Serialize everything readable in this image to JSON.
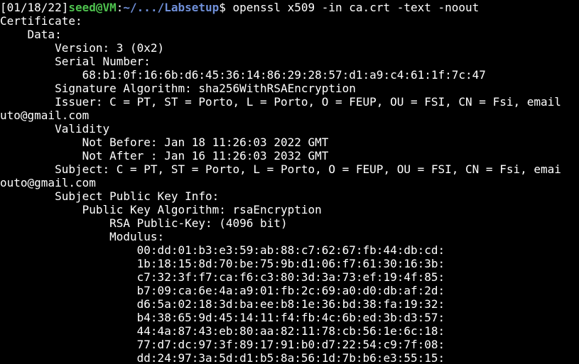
{
  "colors": {
    "background": "#000000",
    "text": "#ffffff",
    "user_host": "#4ec24e",
    "path": "#6f8fd8"
  },
  "prompt": {
    "date": "[01/18/22]",
    "user_host": "seed@VM",
    "colon": ":",
    "path": "~/.../Labsetup",
    "dollar": "$ ",
    "command": "openssl x509 -in ca.crt -text -noout"
  },
  "output_lines": [
    "Certificate:",
    "    Data:",
    "        Version: 3 (0x2)",
    "        Serial Number:",
    "            68:b1:0f:16:6b:d6:45:36:14:86:29:28:57:d1:a9:c4:61:1f:7c:47",
    "        Signature Algorithm: sha256WithRSAEncryption",
    "        Issuer: C = PT, ST = Porto, L = Porto, O = FEUP, OU = FSI, CN = Fsi, email",
    "uto@gmail.com",
    "        Validity",
    "            Not Before: Jan 18 11:26:03 2022 GMT",
    "            Not After : Jan 16 11:26:03 2032 GMT",
    "        Subject: C = PT, ST = Porto, L = Porto, O = FEUP, OU = FSI, CN = Fsi, emai",
    "outo@gmail.com",
    "        Subject Public Key Info:",
    "            Public Key Algorithm: rsaEncryption",
    "                RSA Public-Key: (4096 bit)",
    "                Modulus:",
    "                    00:dd:01:b3:e3:59:ab:88:c7:62:67:fb:44:db:cd:",
    "                    1b:18:15:8d:70:be:75:9b:d1:06:f7:61:30:16:3b:",
    "                    c7:32:3f:f7:ca:f6:c3:80:3d:3a:73:ef:19:4f:85:",
    "                    b7:09:ca:6e:4a:a9:01:fb:2c:69:a0:d0:db:af:2d:",
    "                    d6:5a:02:18:3d:ba:ee:b8:1e:36:bd:38:fa:19:32:",
    "                    b4:38:65:9d:45:14:11:f4:fb:4c:6b:ed:3b:d3:57:",
    "                    44:4a:87:43:eb:80:aa:82:11:78:cb:56:1e:6c:18:",
    "                    77:d7:dc:97:3f:89:17:91:b0:d7:22:54:c9:7f:08:",
    "                    dd:24:97:3a:5d:d1:b5:8a:56:1d:7b:b6:e3:55:15:"
  ]
}
